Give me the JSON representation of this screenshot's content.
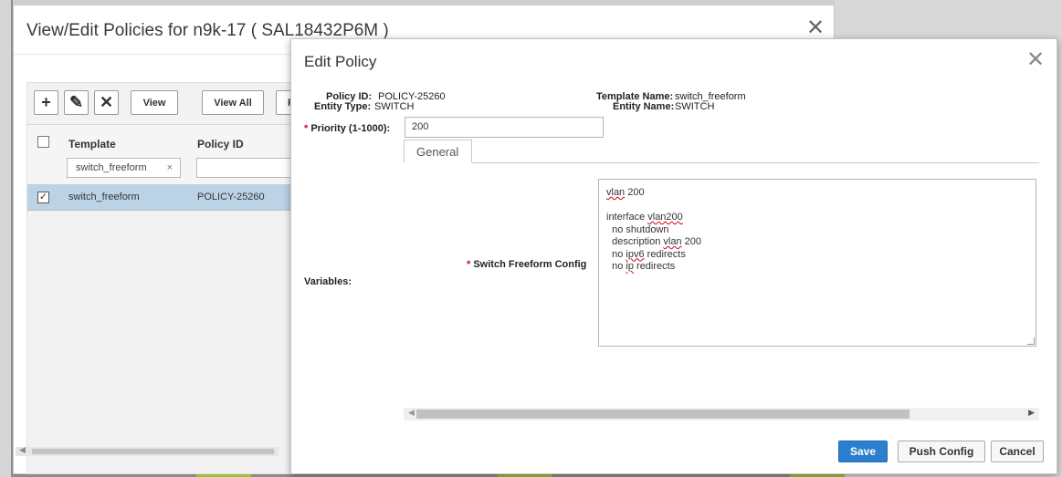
{
  "back_dialog": {
    "title": "View/Edit Policies for n9k-17 ( SAL18432P6M )",
    "close_glyph": "✕",
    "toolbar": {
      "add_glyph": "+",
      "edit_glyph": "✎",
      "delete_glyph": "✕",
      "view_label": "View",
      "view_all_label": "View All",
      "push_label": "Pus"
    },
    "grid": {
      "columns": [
        "Template",
        "Policy ID"
      ],
      "template_filter": "switch_freeform",
      "filter_clear": "×",
      "rows": [
        {
          "checked": "✓",
          "template": "switch_freeform",
          "policy_id": "POLICY-25260"
        }
      ]
    }
  },
  "modal": {
    "title": "Edit Policy",
    "close_glyph": "✕",
    "policy_id_label": "Policy ID:",
    "policy_id_value": "POLICY-25260",
    "entity_type_label": "Entity Type:",
    "entity_type_value": "SWITCH",
    "template_name_label": "Template Name:",
    "template_name_value": "switch_freeform",
    "entity_name_label": "Entity Name:",
    "entity_name_value": "SWITCH",
    "required_mark": "*",
    "priority_label": "Priority (1-1000):",
    "priority_value": "200",
    "tab_general": "General",
    "variables_label": "Variables:",
    "switch_freeform_label": "Switch Freeform Config",
    "config_lines": {
      "l1a": "vlan",
      "l1b": " 200",
      "l3a": "interface ",
      "l3b": "vlan200",
      "l4": "  no shutdown",
      "l5a": "  description ",
      "l5b": "vlan",
      "l5c": " 200",
      "l6a": "  no ",
      "l6b": "ipv6",
      "l6c": " redirects",
      "l7a": "  no ",
      "l7b": "ip",
      "l7c": " redirects"
    },
    "buttons": {
      "save": "Save",
      "push_config": "Push Config",
      "cancel": "Cancel"
    }
  },
  "colors": {
    "primary": "#2b7fce",
    "selected_row": "#bcd3e6",
    "required": "#d0021b"
  }
}
